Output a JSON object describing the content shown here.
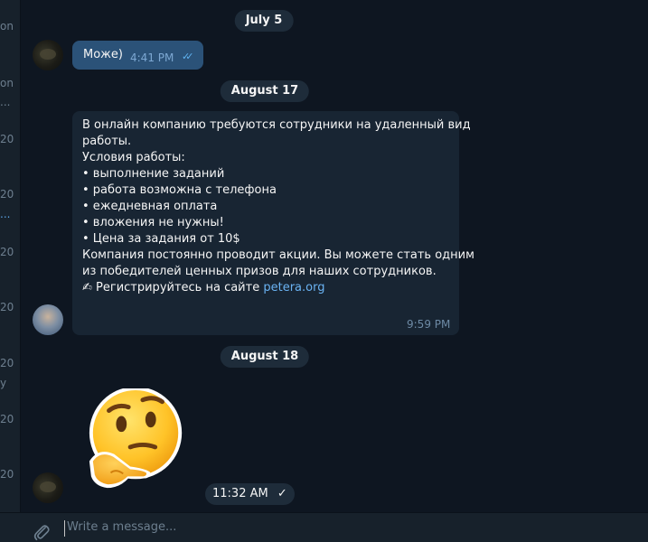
{
  "sidebar": {
    "fragments": [
      {
        "text": "on",
        "accent": false
      },
      {
        "text": "on",
        "accent": false
      },
      {
        "text": "...",
        "accent": false
      },
      {
        "text": "20",
        "accent": false
      },
      {
        "text": "20",
        "accent": false
      },
      {
        "text": "...",
        "accent": true
      },
      {
        "text": "20",
        "accent": false
      },
      {
        "text": "20",
        "accent": false
      },
      {
        "text": "20",
        "accent": false
      },
      {
        "text": "y",
        "accent": false
      },
      {
        "text": "20",
        "accent": false
      },
      {
        "text": "20",
        "accent": false
      },
      {
        "text": "20",
        "accent": false
      }
    ]
  },
  "dates": {
    "d1": "July 5",
    "d2": "August 17",
    "d3": "August 18"
  },
  "messages": {
    "m1": {
      "text": "Може)",
      "time": "4:41 PM"
    },
    "m2": {
      "lines": [
        "В онлайн компанию требуются сотрудники на удаленный вид",
        "работы.",
        "",
        "Условия работы:",
        "• выполнение заданий",
        "• работа возможна с телефона",
        "• ежедневная оплата",
        "• вложения не нужны!",
        "• Цена за задания от 10$",
        "Компания постоянно проводит акции. Вы можете стать одним",
        "из победителей ценных призов для наших сотрудников.",
        ""
      ],
      "cta_prefix": "✍ Регистрируйтесь на сайте ",
      "link": "petera.org",
      "time": "9:59 PM"
    },
    "m3": {
      "time": "11:32 AM",
      "check": "✓"
    }
  },
  "composer": {
    "placeholder": "Write a message..."
  },
  "colors": {
    "accent": "#5aa1e0",
    "outgoing": "#2b5278",
    "incoming": "#182533",
    "background": "#0e1621"
  }
}
